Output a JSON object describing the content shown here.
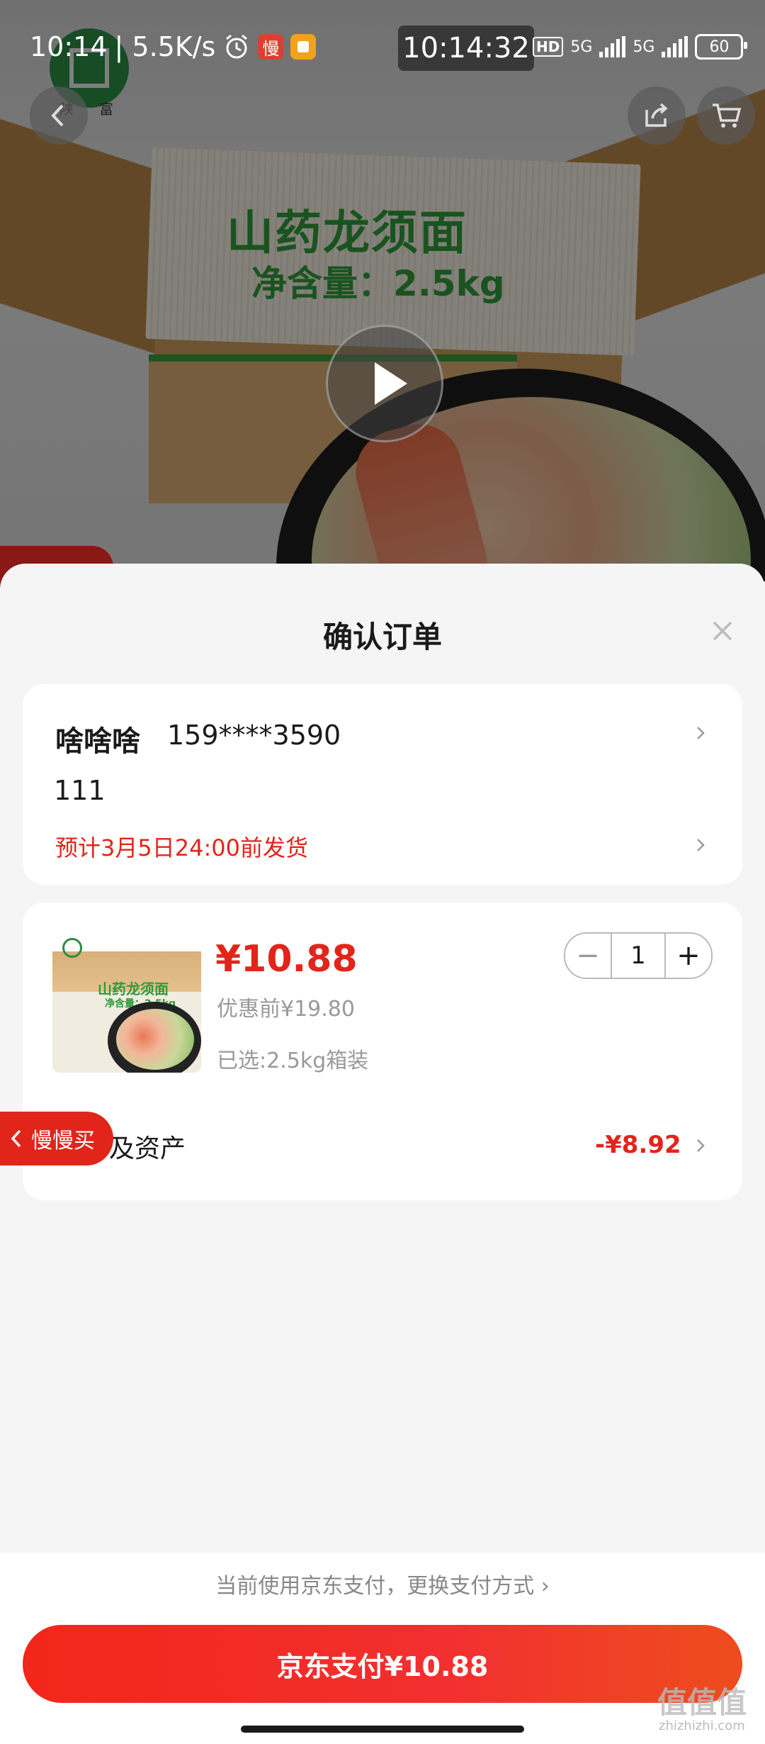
{
  "status_bar": {
    "time": "10:14",
    "net_speed": "| 5.5K/s",
    "app_badge_text": "慢",
    "clock": "10:14:32",
    "hd_label": "HD",
    "sig1_label": "5G",
    "sig2_label": "5G",
    "battery": "60"
  },
  "hero": {
    "box_title": "山药龙须面",
    "box_weight": "净含量：2.5kg",
    "logo_caption_left": "陕",
    "logo_caption_right": "富"
  },
  "sheet": {
    "title": "确认订单",
    "address": {
      "name": "啥啥啥",
      "phone": "159****3590",
      "detail": "111",
      "eta": "预计3月5日24:00前发货"
    },
    "product": {
      "thumb_title": "山药龙须面",
      "thumb_weight": "净含量：2.5kg",
      "price": "¥10.88",
      "original_price": "优惠前¥19.80",
      "spec": "已选:2.5kg箱装",
      "quantity": "1",
      "minus_label": "−",
      "plus_label": "+"
    },
    "asset": {
      "label": "及资产",
      "value": "-¥8.92"
    },
    "float_tab": "慢慢买"
  },
  "bottom": {
    "pay_tip": "当前使用京东支付，更换支付方式 ›",
    "pay_button": "京东支付¥10.88"
  },
  "watermark": {
    "mark": "值值值",
    "url": "zhizhizhi.com"
  },
  "colors": {
    "accent_red": "#e1251b",
    "brand_green": "#2f9a3a"
  }
}
